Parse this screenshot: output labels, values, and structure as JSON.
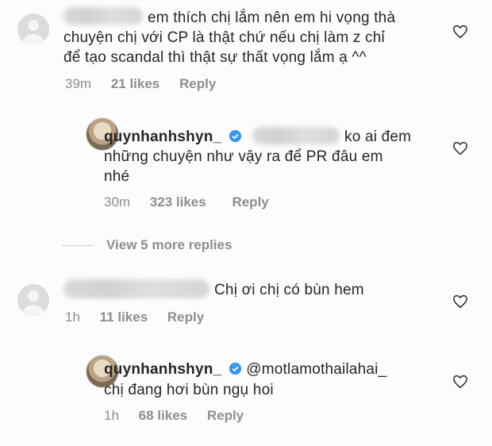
{
  "comments": [
    {
      "text_lines": [
        "em thích chị lắm nên em hi vọng thà",
        "chuyện chị với CP là thật chứ nếu chị làm z chỉ",
        "để tạo scandal thì thật sự thất vọng lắm ạ ^^"
      ],
      "time": "39m",
      "likes": "21 likes",
      "reply": "Reply"
    },
    {
      "username": "quynhanhshyn_",
      "text_lines": [
        "ko ai đem",
        "những chuyện như vậy ra để PR đâu em",
        "nhé"
      ],
      "time": "30m",
      "likes": "323 likes",
      "reply": "Reply"
    },
    {
      "text_lines": [
        "Chị ơi chị có bùn hem"
      ],
      "time": "1h",
      "likes": "11 likes",
      "reply": "Reply"
    },
    {
      "username": "quynhanhshyn_",
      "mention": "@motlamothailahai_",
      "text_lines": [
        "chị đang hơi bùn ngụ hoi"
      ],
      "time": "1h",
      "likes": "68 likes",
      "reply": "Reply"
    }
  ],
  "view_more": "View 5 more replies",
  "colors": {
    "text": "#262626",
    "meta": "#8e8e8e",
    "verified": "#3897f0"
  },
  "icons": {
    "heart": "heart-outline-icon",
    "verified": "verified-badge-icon"
  }
}
